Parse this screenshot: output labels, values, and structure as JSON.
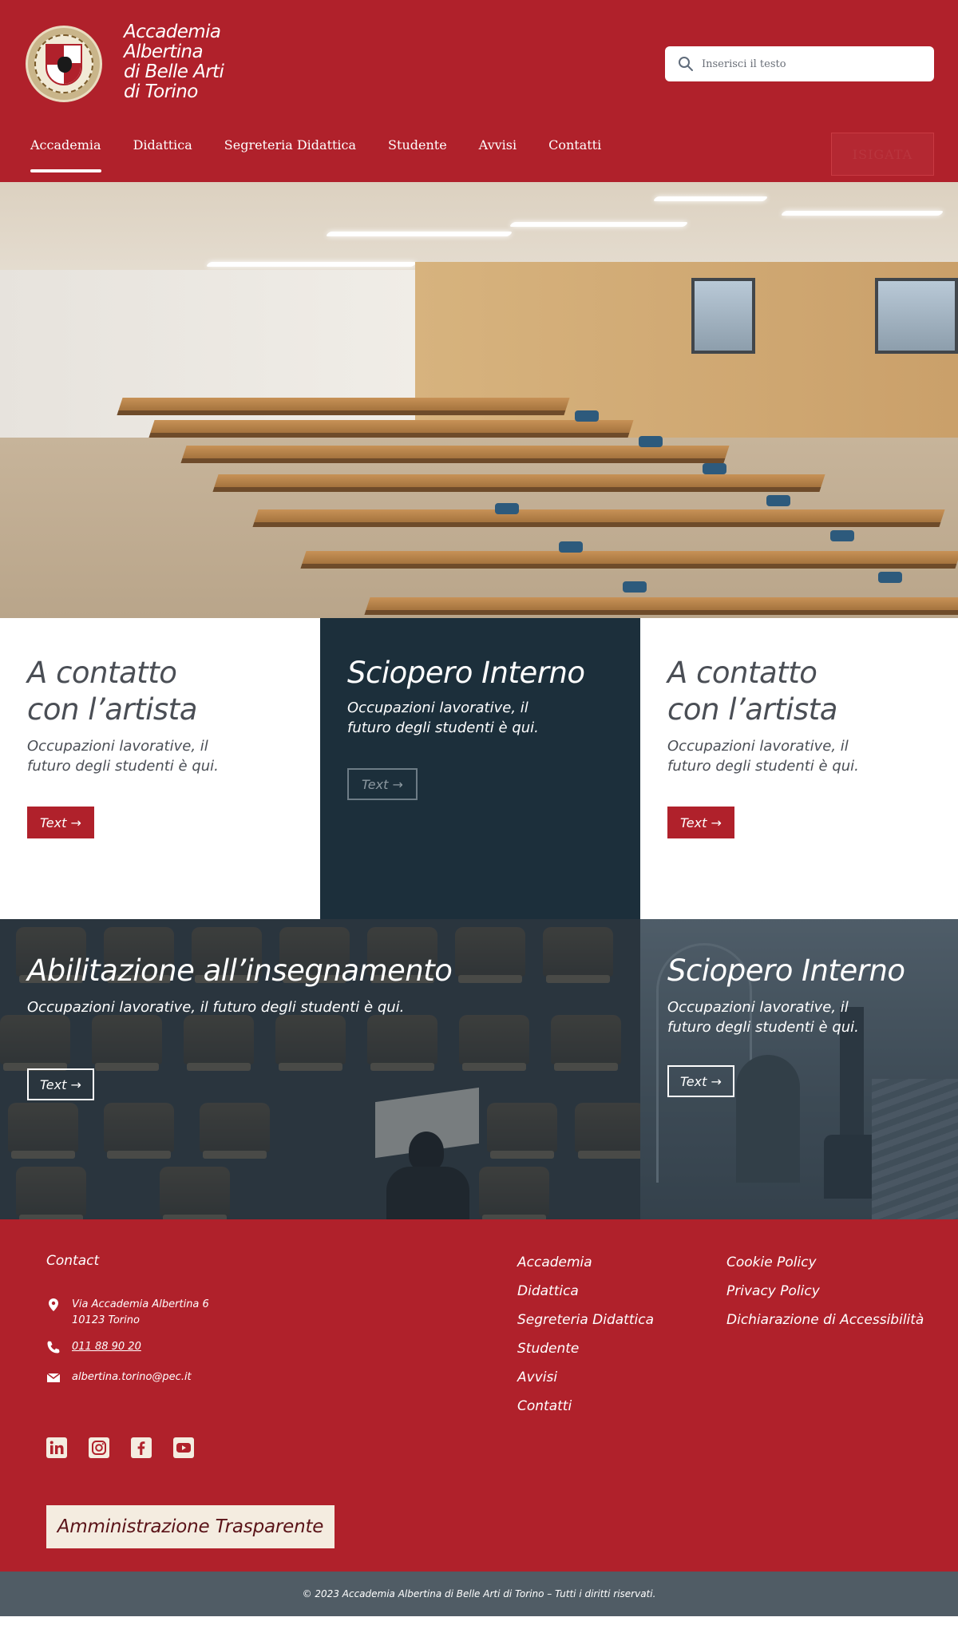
{
  "header": {
    "logo_lines": [
      "Accademia",
      "Albertina",
      "di Belle Arti",
      "di Torino"
    ],
    "search_placeholder": "Inserisci il testo",
    "nav": [
      {
        "label": "Accademia",
        "active": true
      },
      {
        "label": "Didattica"
      },
      {
        "label": "Segreteria Didattica"
      },
      {
        "label": "Studente"
      },
      {
        "label": "Avvisi"
      },
      {
        "label": "Contatti"
      }
    ],
    "signin_label": "ISIGATA"
  },
  "cards": [
    {
      "title_lines": [
        "A contatto",
        "con l’artista"
      ],
      "subtitle_lines": [
        "Occupazioni lavorative, il",
        "futuro degli studenti è qui."
      ],
      "button": "Text →"
    },
    {
      "title_lines": [
        "Sciopero Interno"
      ],
      "subtitle_lines": [
        "Occupazioni lavorative, il",
        "futuro degli studenti è qui."
      ],
      "button": "Text →"
    },
    {
      "title_lines": [
        "A contatto",
        "con l’artista"
      ],
      "subtitle_lines": [
        "Occupazioni lavorative, il",
        "futuro degli studenti è qui."
      ],
      "button": "Text →"
    }
  ],
  "image_cards": [
    {
      "title": "Abilitazione all’insegnamento",
      "subtitle_lines": [
        "Occupazioni lavorative, il futuro degli studenti è qui."
      ],
      "button": "Text →"
    },
    {
      "title": "Sciopero Interno",
      "subtitle_lines": [
        "Occupazioni lavorative, il",
        "futuro degli studenti è qui."
      ],
      "button": "Text →"
    }
  ],
  "footer": {
    "contact_title": "Contact",
    "address_lines": [
      "Via Accademia Albertina 6",
      "10123 Torino"
    ],
    "phone": "011 88 90 20",
    "email": "albertina.torino@pec.it",
    "links_col1": [
      "Accademia",
      "Didattica",
      "Segreteria Didattica",
      "Studente",
      "Avvisi",
      "Contatti"
    ],
    "links_col2": [
      "Cookie Policy",
      "Privacy Policy",
      "Dichiarazione di Accessibilità"
    ],
    "social_icons": [
      "linkedin-icon",
      "instagram-icon",
      "facebook-icon",
      "youtube-icon"
    ],
    "transparency_button": "Amministrazione Trasparente",
    "copyright": "© 2023 Accademia Albertina di Belle Arti di Torino – Tutti i diritti riservati."
  },
  "colors": {
    "brand_red": "#b0212b",
    "dark_navy": "#1c2f3b",
    "footer_bar": "#505c65",
    "cream": "#f4ece0"
  }
}
